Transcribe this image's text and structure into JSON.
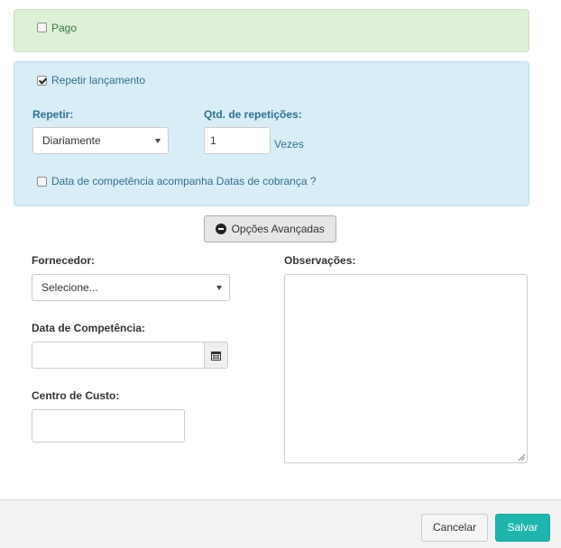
{
  "payment": {
    "paid_label": "Pago",
    "paid_checked": false
  },
  "repeat": {
    "repeat_label": "Repetir lançamento",
    "repeat_checked": true,
    "frequency_label": "Repetir:",
    "frequency_value": "Diariamente",
    "qty_label": "Qtd. de repetições:",
    "qty_value": "1",
    "qty_unit": "Vezes",
    "competence_follows_label": "Data de competência acompanha Datas de cobrança ?",
    "competence_follows_checked": false
  },
  "advanced_button_label": "Opções Avançadas",
  "form": {
    "supplier_label": "Fornecedor:",
    "supplier_value": "Selecione...",
    "competence_date_label": "Data de Competência:",
    "competence_date_value": "",
    "cost_center_label": "Centro de Custo:",
    "cost_center_value": "",
    "notes_label": "Observações:",
    "notes_value": ""
  },
  "footer": {
    "cancel_label": "Cancelar",
    "save_label": "Salvar"
  },
  "colors": {
    "success_bg": "#dff0d8",
    "info_bg": "#d9edf7",
    "label_blue": "#31708f",
    "label_green": "#3c763d",
    "save_button": "#1fb5ad"
  }
}
